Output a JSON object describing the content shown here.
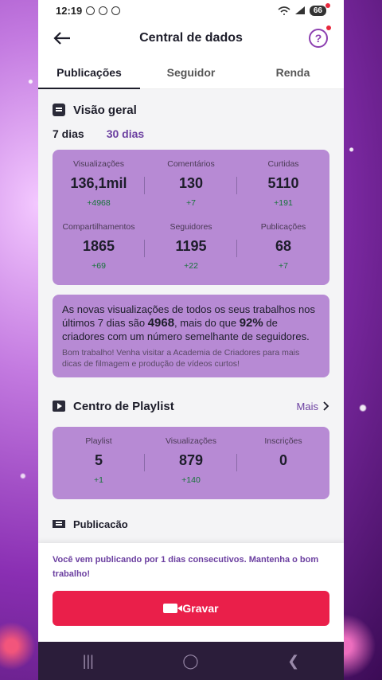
{
  "status_bar": {
    "time": "12:19",
    "battery": "66"
  },
  "header": {
    "title": "Central de dados",
    "help": "?"
  },
  "tabs": [
    {
      "label": "Publicações",
      "active": true
    },
    {
      "label": "Seguidor",
      "active": false
    },
    {
      "label": "Renda",
      "active": false
    }
  ],
  "overview": {
    "title": "Visão geral",
    "period_7": "7 dias",
    "period_30": "30 dias",
    "stats": [
      {
        "label": "Visualizações",
        "value": "136,1mil",
        "delta": "+4968"
      },
      {
        "label": "Comentários",
        "value": "130",
        "delta": "+7"
      },
      {
        "label": "Curtidas",
        "value": "5110",
        "delta": "+191"
      },
      {
        "label": "Compartilhamentos",
        "value": "1865",
        "delta": "+69"
      },
      {
        "label": "Seguidores",
        "value": "1195",
        "delta": "+22"
      },
      {
        "label": "Publicações",
        "value": "68",
        "delta": "+7"
      }
    ]
  },
  "message": {
    "part1": "As novas visualizações de todos os seus trabalhos nos últimos 7 dias são ",
    "highlight1": "4968",
    "part2": ", mais do que ",
    "highlight2": "92%",
    "part3": " de criadores com um número semelhante de seguidores.",
    "sub": "Bom trabalho! Venha visitar a Academia de Criadores para mais dicas de filmagem e produção de vídeos curtos!"
  },
  "playlist": {
    "title": "Centro de Playlist",
    "more": "Mais",
    "stats": [
      {
        "label": "Playlist",
        "value": "5",
        "delta": "+1"
      },
      {
        "label": "Visualizações",
        "value": "879",
        "delta": "+140"
      },
      {
        "label": "Inscrições",
        "value": "0",
        "delta": ""
      }
    ]
  },
  "peek": {
    "title": "Publicação"
  },
  "bottom": {
    "streak": "Você vem publicando por 1 dias consecutivos. Mantenha o bom trabalho!",
    "record_label": "Gravar"
  },
  "colors": {
    "accent": "#8c3fb0",
    "card": "#b78ad4",
    "record": "#ea1f4a",
    "positive": "#16733a"
  }
}
